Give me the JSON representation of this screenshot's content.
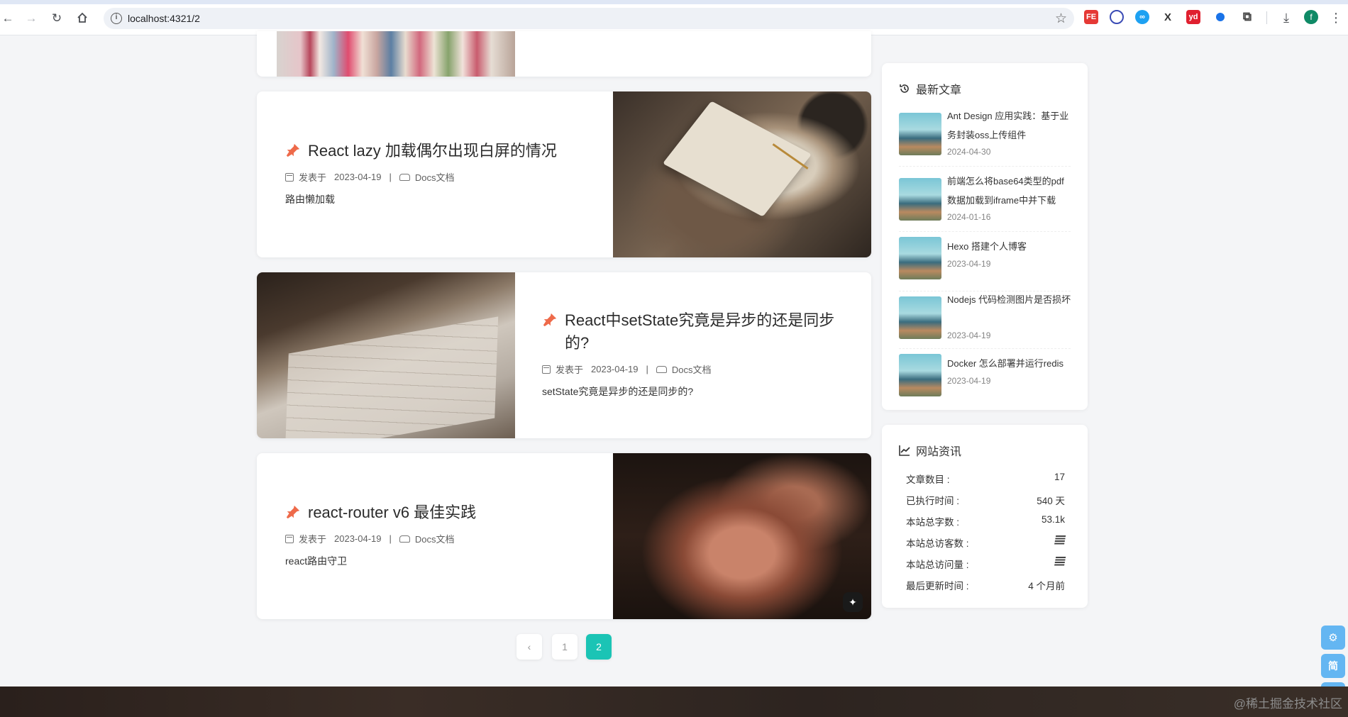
{
  "browser": {
    "url": "localhost:4321/2",
    "profile_initial": "f"
  },
  "posts": [
    {
      "title": "React lazy 加载偶尔出现白屏的情况",
      "meta_label": "发表于",
      "date": "2023-04-19",
      "sep": "|",
      "category": "Docs文档",
      "excerpt": "路由懒加载"
    },
    {
      "title": "React中setState究竟是异步的还是同步的?",
      "meta_label": "发表于",
      "date": "2023-04-19",
      "sep": "|",
      "category": "Docs文档",
      "excerpt": "setState究竟是异步的还是同步的?"
    },
    {
      "title": "react-router v6 最佳实践",
      "meta_label": "发表于",
      "date": "2023-04-19",
      "sep": "|",
      "category": "Docs文档",
      "excerpt": "react路由守卫"
    }
  ],
  "pagination": {
    "prev_label": "‹",
    "pages": [
      "1",
      "2"
    ],
    "current": "2"
  },
  "sidebar": {
    "recent_title": "最新文章",
    "recent": [
      {
        "title": "Ant Design 应用实践：基于业务封装oss上传组件",
        "date": "2024-04-30"
      },
      {
        "title": "前端怎么将base64类型的pdf数据加载到iframe中并下载",
        "date": "2024-01-16"
      },
      {
        "title": "Hexo 搭建个人博客",
        "date": "2023-04-19"
      },
      {
        "title": "Nodejs 代码检测图片是否损坏",
        "date": "2023-04-19"
      },
      {
        "title": "Docker 怎么部署并运行redis",
        "date": "2023-04-19"
      }
    ],
    "info_title": "网站资讯",
    "info": [
      {
        "label": "文章数目 :",
        "value": "17"
      },
      {
        "label": "已执行时间 :",
        "value": "540 天"
      },
      {
        "label": "本站总字数 :",
        "value": "53.1k"
      },
      {
        "label": "本站总访客数 :",
        "value": ""
      },
      {
        "label": "本站总访问量 :",
        "value": ""
      },
      {
        "label": "最后更新时间 :",
        "value": "4 个月前"
      }
    ]
  },
  "right_buttons": {
    "settings": "⚙",
    "simplified": "简",
    "to_top": "↑"
  },
  "watermark": "@稀土掘金技术社区",
  "colors": {
    "accent": "#1bc4b5",
    "pin": "#ee6a4a",
    "side_button": "#64b6f2"
  }
}
